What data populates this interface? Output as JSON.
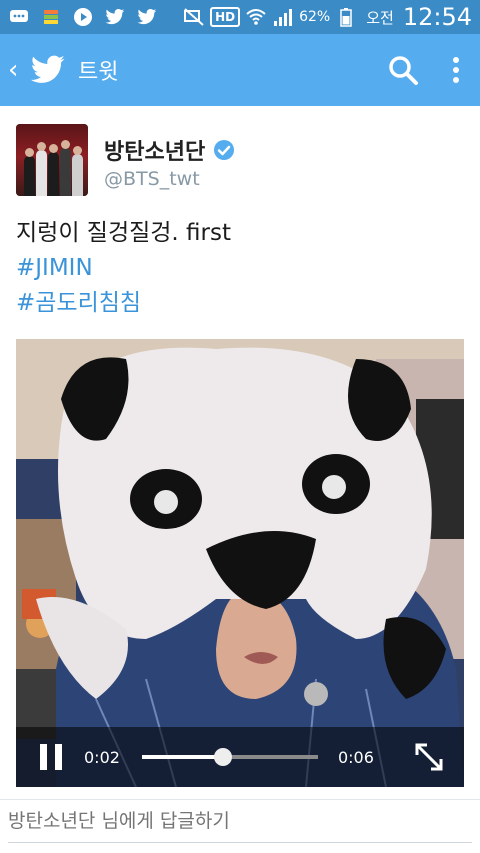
{
  "status_bar": {
    "battery_percent": "62%",
    "ampm": "오전",
    "time": "12:54",
    "hd_label": "HD",
    "icons": [
      "chat-icon",
      "layers-icon",
      "play-icon",
      "twitter-icon",
      "twitter-icon",
      "mute-icon",
      "hd-icon",
      "wifi-icon",
      "signal-icon",
      "battery-icon"
    ]
  },
  "header": {
    "title": "트윗",
    "icons": [
      "back-icon",
      "twitter-bird-icon",
      "search-icon",
      "more-vert-icon"
    ]
  },
  "tweet": {
    "display_name": "방탄소년단",
    "handle": "@BTS_twt",
    "text_line": "지렁이 질겅질겅. first",
    "hashtags": [
      "#JIMIN",
      "#곰도리침침"
    ],
    "verified_icon": "verified-badge-icon"
  },
  "video": {
    "current_time": "0:02",
    "duration": "0:06",
    "progress": 0.46,
    "icons": [
      "pause-icon",
      "expand-icon"
    ]
  },
  "reply": {
    "placeholder": "방탄소년단 님에게 답글하기"
  },
  "colors": {
    "status_bar": "#3a8bc6",
    "app_bar": "#55acee",
    "hashtag": "#3b94d9",
    "handle": "#8899a6"
  }
}
